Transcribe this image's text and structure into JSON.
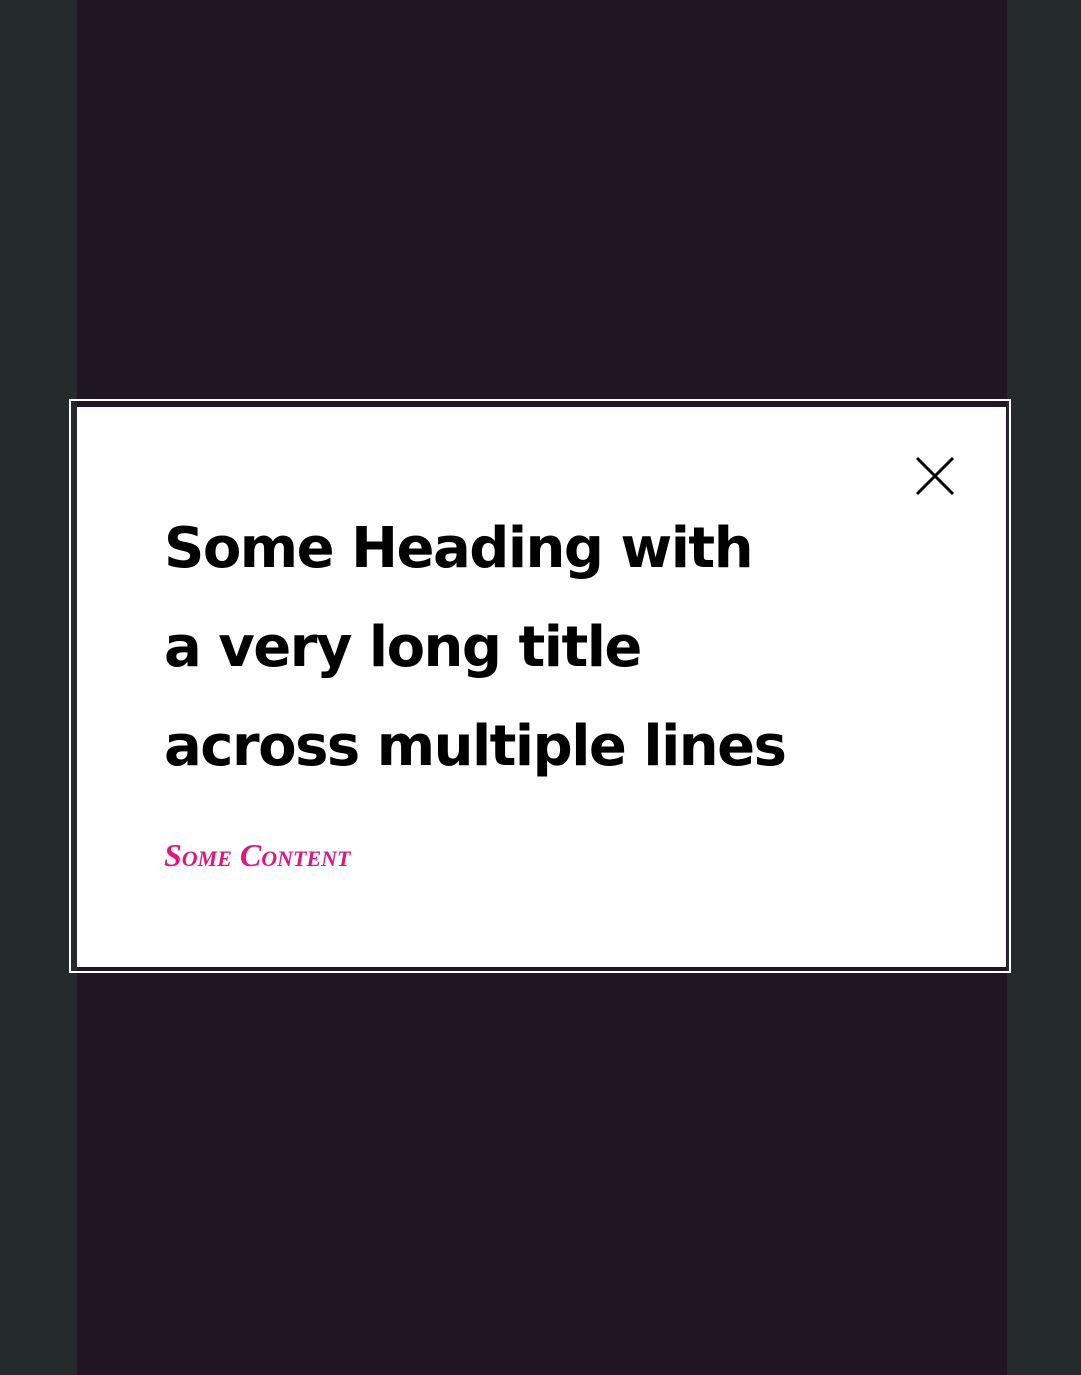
{
  "dialog": {
    "heading": "Some Heading with a very long title across multiple lines",
    "content": "Some Content",
    "close_icon": "close-icon"
  },
  "colors": {
    "page_background": "#252a2d",
    "backdrop": "#221523",
    "dialog_background": "#ffffff",
    "heading_text": "#000000",
    "content_text": "#e3157d"
  }
}
